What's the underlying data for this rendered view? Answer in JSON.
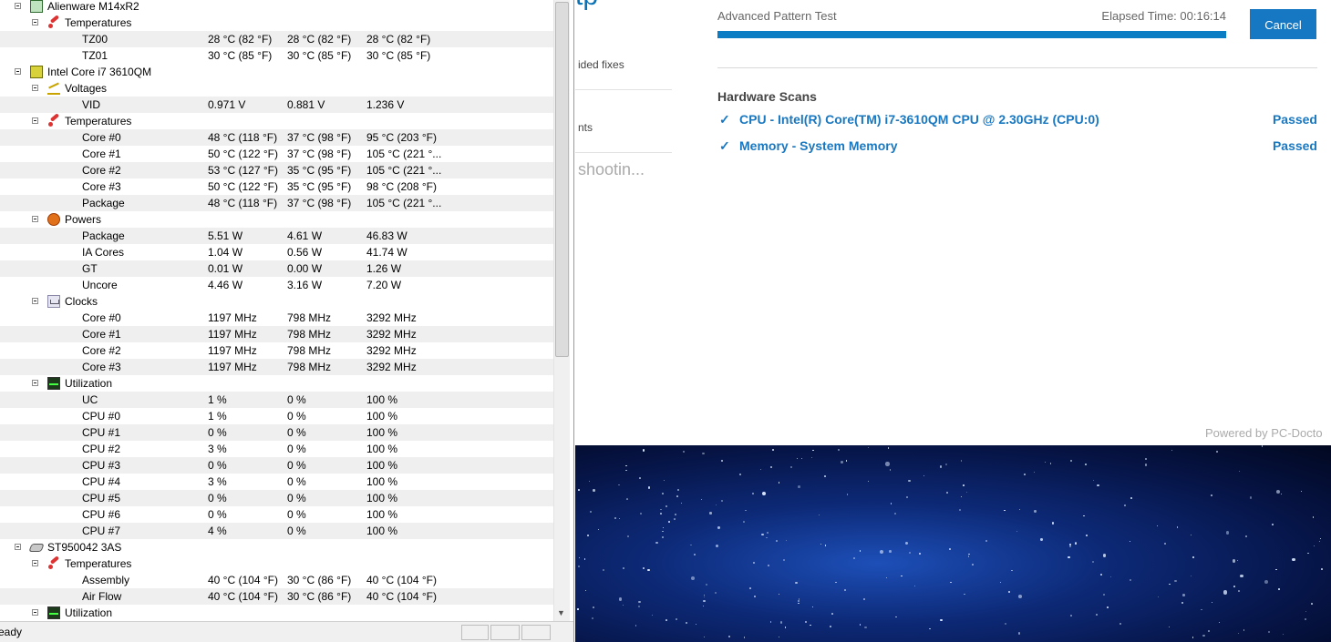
{
  "hwmonitor": {
    "rows": [
      {
        "label": "Alienware M14xR2",
        "icon": "motherboard-icon",
        "level": 0,
        "v": [
          "",
          "",
          ""
        ]
      },
      {
        "label": "Temperatures",
        "icon": "thermometer-icon",
        "level": 1,
        "v": [
          "",
          "",
          ""
        ]
      },
      {
        "label": "TZ00",
        "icon": "",
        "level": 2,
        "v": [
          "28 °C  (82 °F)",
          "28 °C  (82 °F)",
          "28 °C  (82 °F)"
        ]
      },
      {
        "label": "TZ01",
        "icon": "",
        "level": 2,
        "v": [
          "30 °C  (85 °F)",
          "30 °C  (85 °F)",
          "30 °C  (85 °F)"
        ]
      },
      {
        "label": "Intel Core i7 3610QM",
        "icon": "cpu-icon",
        "level": 0,
        "v": [
          "",
          "",
          ""
        ]
      },
      {
        "label": "Voltages",
        "icon": "voltage-icon",
        "level": 1,
        "v": [
          "",
          "",
          ""
        ]
      },
      {
        "label": "VID",
        "icon": "",
        "level": 2,
        "v": [
          "0.971 V",
          "0.881 V",
          "1.236 V"
        ]
      },
      {
        "label": "Temperatures",
        "icon": "thermometer-icon",
        "level": 1,
        "v": [
          "",
          "",
          ""
        ]
      },
      {
        "label": "Core #0",
        "icon": "",
        "level": 2,
        "v": [
          "48 °C  (118 °F)",
          "37 °C  (98 °F)",
          "95 °C  (203 °F)"
        ]
      },
      {
        "label": "Core #1",
        "icon": "",
        "level": 2,
        "v": [
          "50 °C  (122 °F)",
          "37 °C  (98 °F)",
          "105 °C  (221 °..."
        ]
      },
      {
        "label": "Core #2",
        "icon": "",
        "level": 2,
        "v": [
          "53 °C  (127 °F)",
          "35 °C  (95 °F)",
          "105 °C  (221 °..."
        ]
      },
      {
        "label": "Core #3",
        "icon": "",
        "level": 2,
        "v": [
          "50 °C  (122 °F)",
          "35 °C  (95 °F)",
          "98 °C  (208 °F)"
        ]
      },
      {
        "label": "Package",
        "icon": "",
        "level": 2,
        "v": [
          "48 °C  (118 °F)",
          "37 °C  (98 °F)",
          "105 °C  (221 °..."
        ]
      },
      {
        "label": "Powers",
        "icon": "power-icon",
        "level": 1,
        "v": [
          "",
          "",
          ""
        ]
      },
      {
        "label": "Package",
        "icon": "",
        "level": 2,
        "v": [
          "5.51 W",
          "4.61 W",
          "46.83 W"
        ]
      },
      {
        "label": "IA Cores",
        "icon": "",
        "level": 2,
        "v": [
          "1.04 W",
          "0.56 W",
          "41.74 W"
        ]
      },
      {
        "label": "GT",
        "icon": "",
        "level": 2,
        "v": [
          "0.01 W",
          "0.00 W",
          "1.26 W"
        ]
      },
      {
        "label": "Uncore",
        "icon": "",
        "level": 2,
        "v": [
          "4.46 W",
          "3.16 W",
          "7.20 W"
        ]
      },
      {
        "label": "Clocks",
        "icon": "clock-icon",
        "level": 1,
        "v": [
          "",
          "",
          ""
        ]
      },
      {
        "label": "Core #0",
        "icon": "",
        "level": 2,
        "v": [
          "1197 MHz",
          "798 MHz",
          "3292 MHz"
        ]
      },
      {
        "label": "Core #1",
        "icon": "",
        "level": 2,
        "v": [
          "1197 MHz",
          "798 MHz",
          "3292 MHz"
        ]
      },
      {
        "label": "Core #2",
        "icon": "",
        "level": 2,
        "v": [
          "1197 MHz",
          "798 MHz",
          "3292 MHz"
        ]
      },
      {
        "label": "Core #3",
        "icon": "",
        "level": 2,
        "v": [
          "1197 MHz",
          "798 MHz",
          "3292 MHz"
        ]
      },
      {
        "label": "Utilization",
        "icon": "utilization-icon",
        "level": 1,
        "v": [
          "",
          "",
          ""
        ]
      },
      {
        "label": "UC",
        "icon": "",
        "level": 2,
        "v": [
          "1 %",
          "0 %",
          "100 %"
        ]
      },
      {
        "label": "CPU #0",
        "icon": "",
        "level": 2,
        "v": [
          "1 %",
          "0 %",
          "100 %"
        ]
      },
      {
        "label": "CPU #1",
        "icon": "",
        "level": 2,
        "v": [
          "0 %",
          "0 %",
          "100 %"
        ]
      },
      {
        "label": "CPU #2",
        "icon": "",
        "level": 2,
        "v": [
          "3 %",
          "0 %",
          "100 %"
        ]
      },
      {
        "label": "CPU #3",
        "icon": "",
        "level": 2,
        "v": [
          "0 %",
          "0 %",
          "100 %"
        ]
      },
      {
        "label": "CPU #4",
        "icon": "",
        "level": 2,
        "v": [
          "3 %",
          "0 %",
          "100 %"
        ]
      },
      {
        "label": "CPU #5",
        "icon": "",
        "level": 2,
        "v": [
          "0 %",
          "0 %",
          "100 %"
        ]
      },
      {
        "label": "CPU #6",
        "icon": "",
        "level": 2,
        "v": [
          "0 %",
          "0 %",
          "100 %"
        ]
      },
      {
        "label": "CPU #7",
        "icon": "",
        "level": 2,
        "v": [
          "4 %",
          "0 %",
          "100 %"
        ]
      },
      {
        "label": "ST950042 3AS",
        "icon": "disk-icon",
        "level": 0,
        "v": [
          "",
          "",
          ""
        ]
      },
      {
        "label": "Temperatures",
        "icon": "thermometer-icon",
        "level": 1,
        "v": [
          "",
          "",
          ""
        ]
      },
      {
        "label": "Assembly",
        "icon": "",
        "level": 2,
        "v": [
          "40 °C  (104 °F)",
          "30 °C  (86 °F)",
          "40 °C  (104 °F)"
        ]
      },
      {
        "label": "Air Flow",
        "icon": "",
        "level": 2,
        "v": [
          "40 °C  (104 °F)",
          "30 °C  (86 °F)",
          "40 °C  (104 °F)"
        ]
      },
      {
        "label": "Utilization",
        "icon": "utilization-icon",
        "level": 1,
        "v": [
          "",
          "",
          ""
        ]
      }
    ],
    "status_text": "eady"
  },
  "nav": {
    "top_glyph": "tp",
    "item1": "ided fixes",
    "item2": "nts",
    "item3": "shootin..."
  },
  "scan": {
    "test_name": "Advanced Pattern Test",
    "elapsed": "Elapsed Time: 00:16:14",
    "progress": 1.0,
    "cancel_label": "Cancel",
    "section_title": "Hardware Scans",
    "items": [
      {
        "name": "CPU - Intel(R) Core(TM) i7-3610QM CPU @ 2.30GHz (CPU:0)",
        "result": "Passed"
      },
      {
        "name": "Memory - System Memory",
        "result": "Passed"
      }
    ],
    "powered_by": "Powered by PC-Docto"
  },
  "colors": {
    "accent": "#1677c2",
    "progress": "#0b7dc4",
    "wallpaper": "#0d2a78"
  }
}
